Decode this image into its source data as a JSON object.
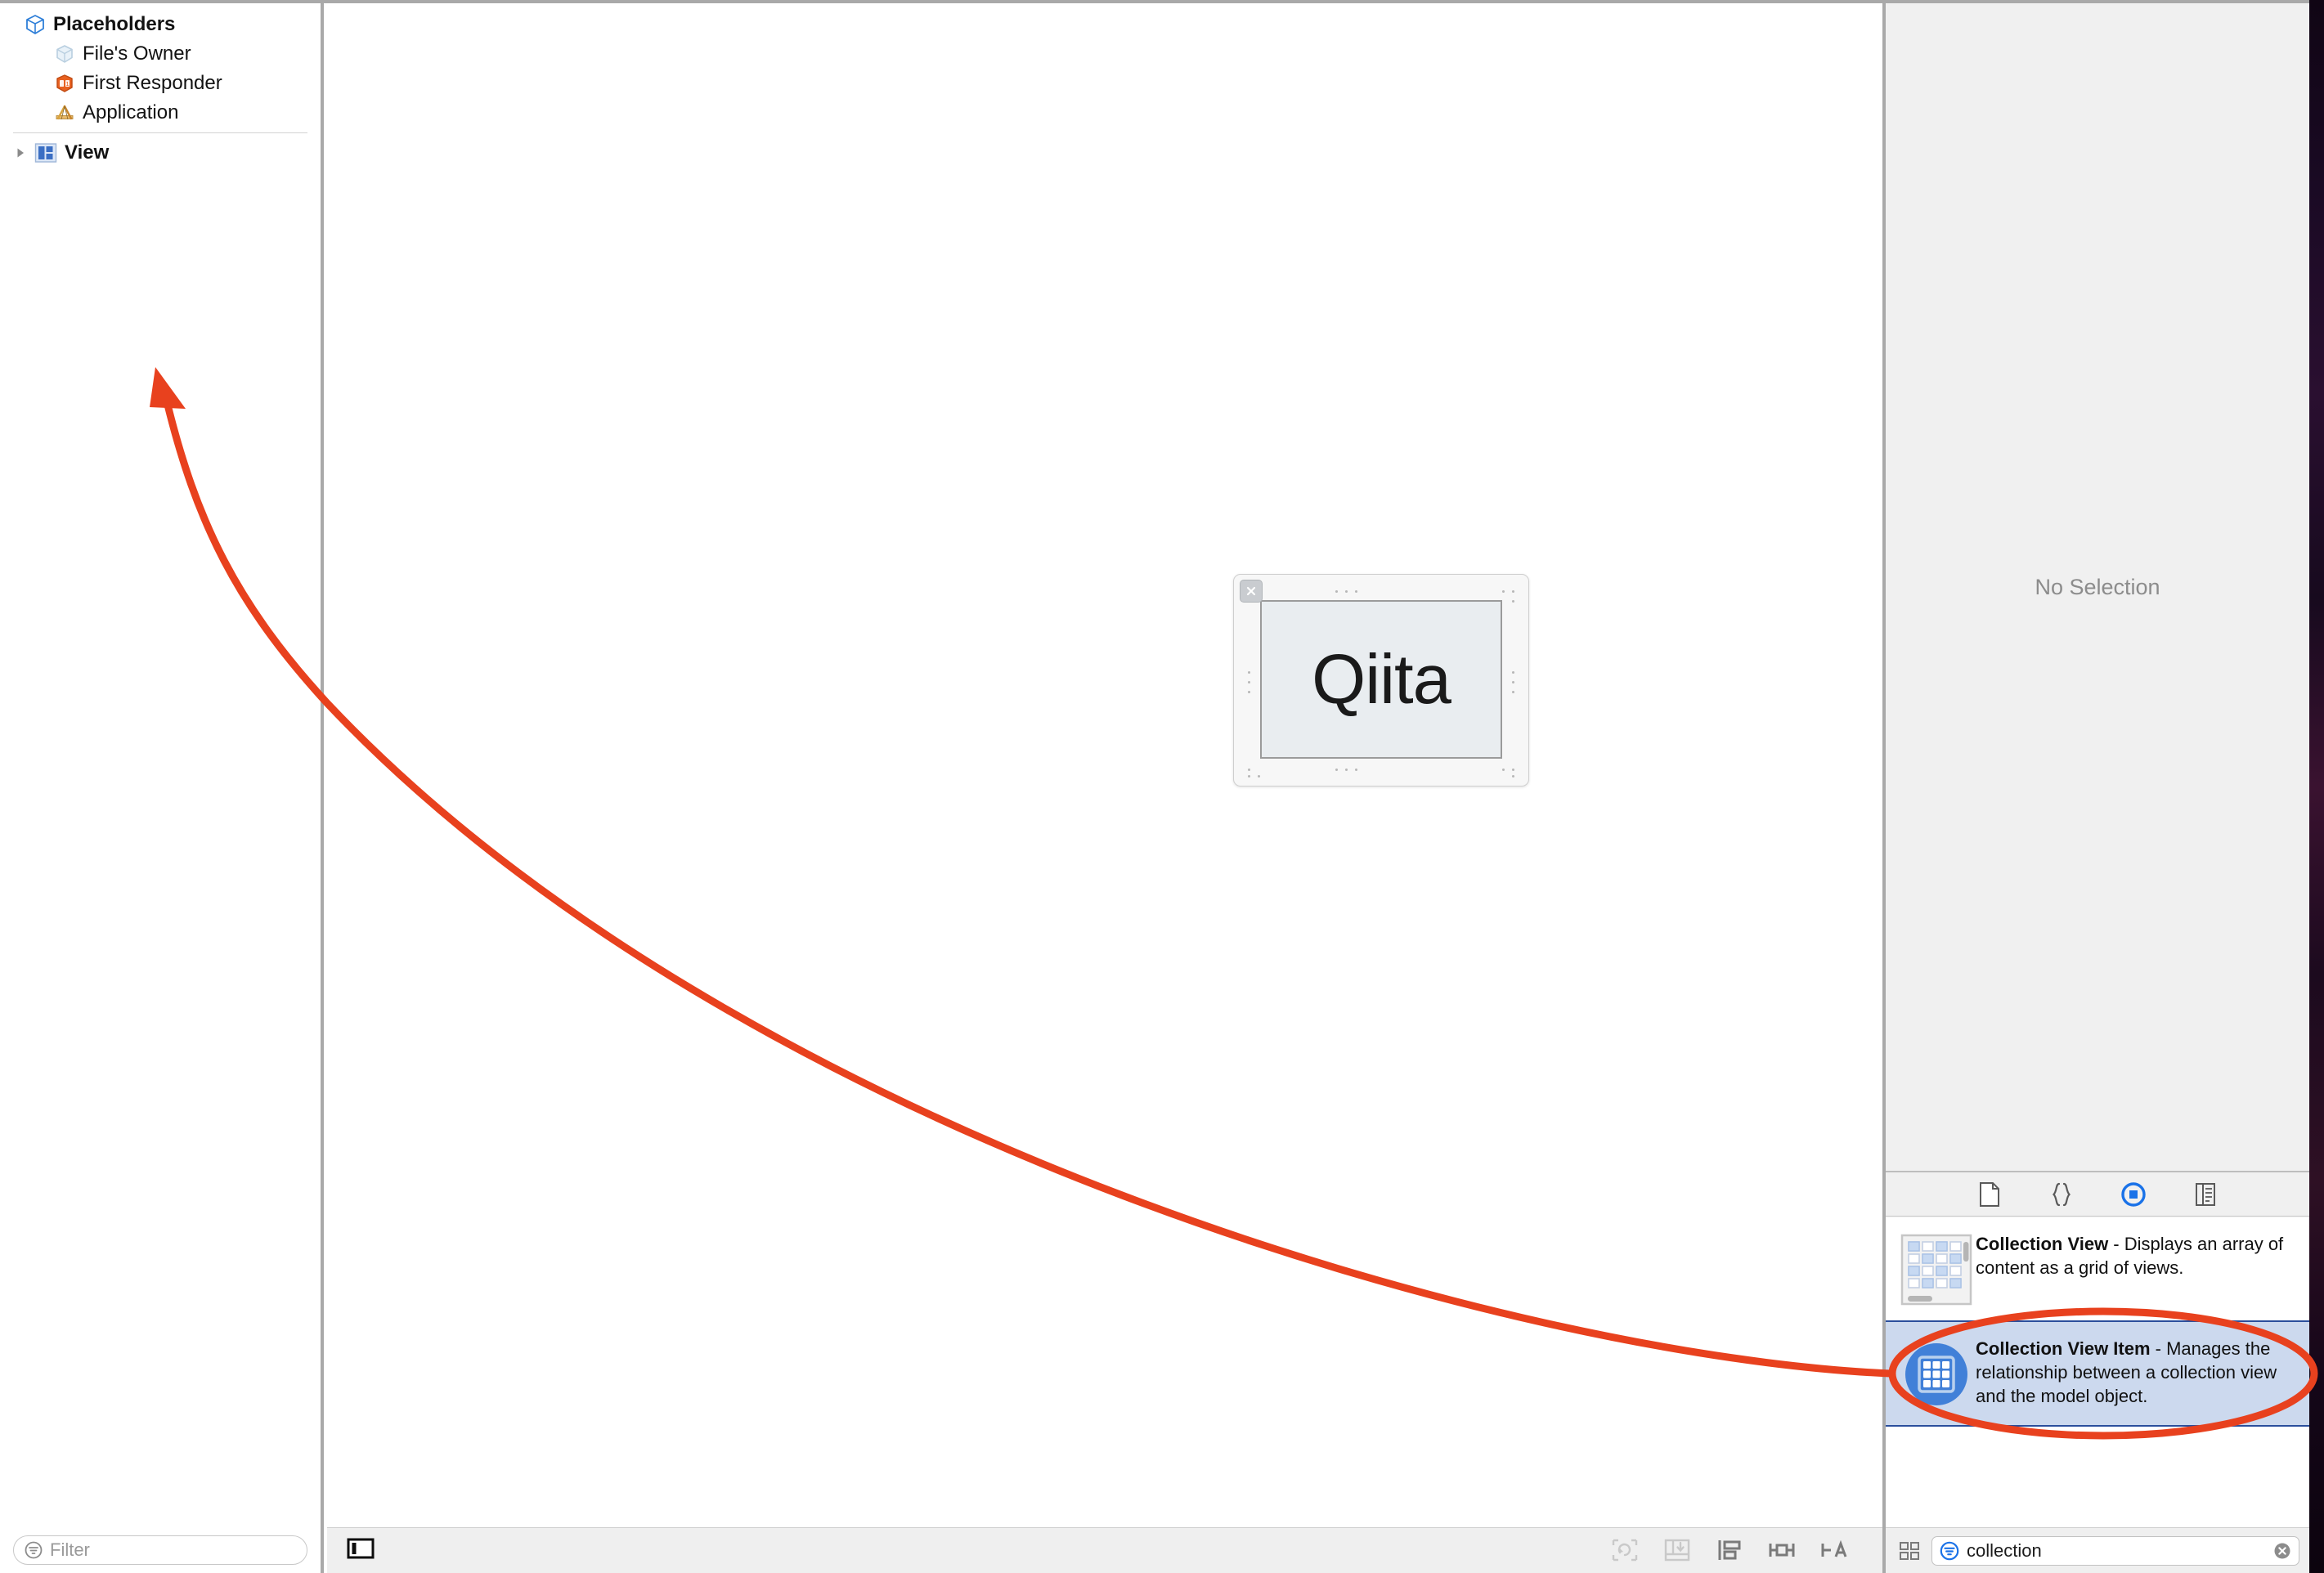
{
  "window": {
    "app": "Xcode Interface Builder"
  },
  "outline": {
    "placeholders_group": {
      "label": "Placeholders",
      "icon": "cube-icon"
    },
    "items": [
      {
        "label": "File's Owner",
        "icon": "files-owner-cube-icon"
      },
      {
        "label": "First Responder",
        "icon": "first-responder-cube-icon"
      },
      {
        "label": "Application",
        "icon": "application-ruler-icon"
      }
    ],
    "objects": [
      {
        "label": "View",
        "icon": "view-icon",
        "expanded": false,
        "twisty": "disclosure-triangle-right"
      }
    ],
    "filter": {
      "placeholder": "Filter",
      "value": "",
      "icon": "filter-icon"
    }
  },
  "canvas": {
    "object_label": "Qiita",
    "close_badge": "close-icon",
    "bottom_bar": {
      "outline_toggle": "document-outline-toggle-icon",
      "constraint_buttons": [
        "update-frames-icon",
        "embed-in-icon",
        "align-icon",
        "add-new-constraints-icon",
        "resolve-auto-layout-issues-icon"
      ]
    }
  },
  "inspector": {
    "no_selection": "No Selection"
  },
  "library": {
    "tabs": [
      {
        "name": "file-template-library",
        "icon": "file-icon",
        "selected": false
      },
      {
        "name": "code-snippet-library",
        "icon": "braces-icon",
        "selected": false
      },
      {
        "name": "object-library",
        "icon": "object-circle-icon",
        "selected": true
      },
      {
        "name": "media-library",
        "icon": "media-icon",
        "selected": false
      }
    ],
    "items": [
      {
        "title": "Collection View",
        "separator": " - ",
        "description": "Displays an array of content as a grid of views.",
        "icon": "collection-view-thumbnail-icon",
        "selected": false
      },
      {
        "title": "Collection View Item",
        "separator": " - ",
        "description": "Manages the relationship between a collection view and the model object.",
        "icon": "collection-view-item-thumbnail-icon",
        "selected": true
      }
    ],
    "view_mode_button": "grid-view-icon",
    "search": {
      "value": "collection",
      "placeholder": "Filter",
      "icon": "filter-icon",
      "clear": "clear-icon"
    }
  },
  "annotation": {
    "arrow_color": "#E8411E",
    "ellipse_color": "#E8411E",
    "target": "Collection View Item",
    "arrow_points_to": "Placeholders tree area"
  },
  "colors": {
    "selection_blue": "#ccd9ee",
    "selection_border": "#2b4f9c",
    "accent_blue": "#1a72e8",
    "annotation_red": "#E8411E",
    "panel_grey": "#f0f0f0",
    "divider_grey": "#a9a9a9"
  }
}
